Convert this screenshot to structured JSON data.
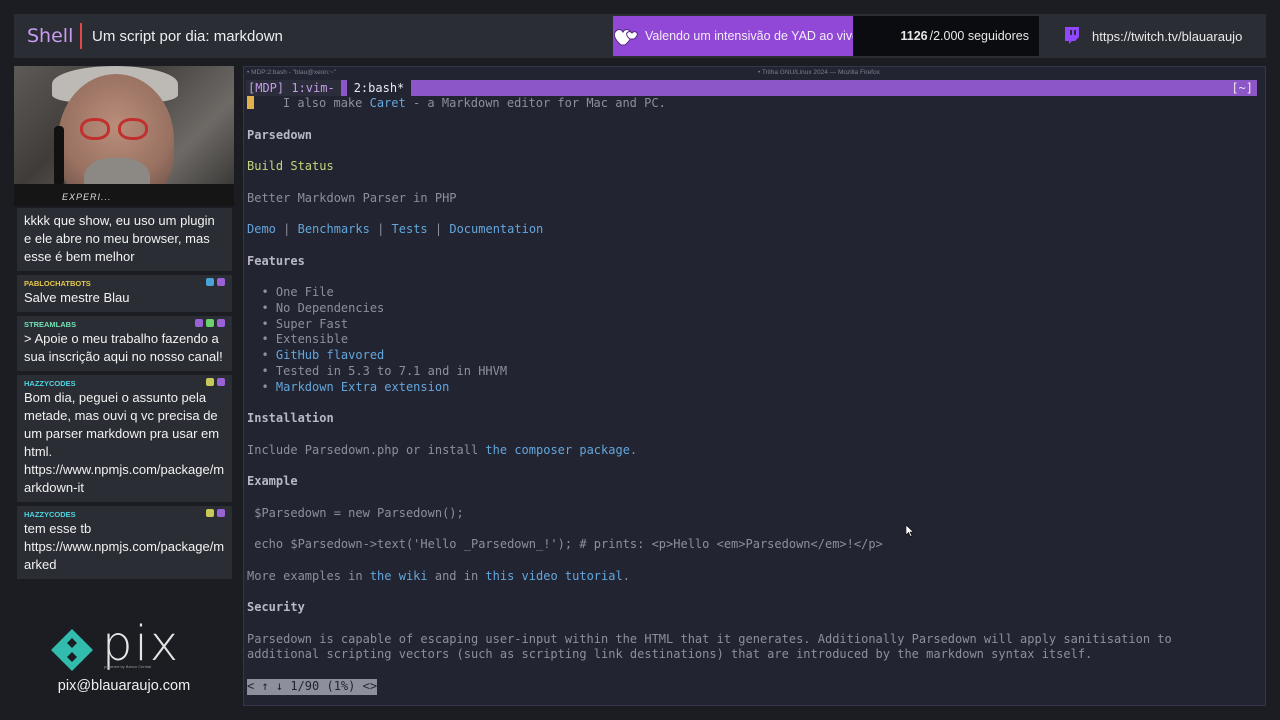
{
  "topbar": {
    "brand": "Shell",
    "title": "Um script por dia: markdown",
    "promo_text": "Valendo um intensivão de YAD ao vivo",
    "followers_count": "1126",
    "followers_goal": "/2.000 seguidores",
    "twitch_url": "https://twitch.tv/blauaraujo",
    "colors": {
      "promo_bg": "#9248d6",
      "brand": "#c89cf0"
    }
  },
  "webcam": {
    "shirt_text": "EXPERI..."
  },
  "chat": [
    {
      "user": "",
      "user_color": "#ffffff",
      "text": "kkkk que show, eu uso um plugin e ele abre no meu browser, mas esse é bem melhor",
      "badges": []
    },
    {
      "user": "PABLOCHATBOTS",
      "user_color": "#e6c84a",
      "text": "Salve mestre Blau",
      "badges": [
        "#4aa3d8",
        "#9a62d6"
      ]
    },
    {
      "user": "STREAMLABS",
      "user_color": "#74e0b4",
      "text": "> Apoie o meu trabalho fazendo a sua inscrição aqui no nosso canal!",
      "badges": [
        "#9a62d6",
        "#6bd36b",
        "#9a62d6"
      ]
    },
    {
      "user": "HAZZYCODES",
      "user_color": "#4fd4e0",
      "text": "Bom dia, peguei o assunto pela metade, mas ouvi q vc precisa de um parser markdown pra usar em html. https://www.npmjs.com/package/markdown-it",
      "badges": [
        "#c9c95a",
        "#9a62d6"
      ]
    },
    {
      "user": "HAZZYCODES",
      "user_color": "#4fd4e0",
      "text": "tem esse tb https://www.npmjs.com/package/marked",
      "badges": [
        "#c9c95a",
        "#9a62d6"
      ]
    }
  ],
  "pix": {
    "word": "pix",
    "sub": "powered by Banco Central",
    "email": "pix@blauaraujo.com"
  },
  "terminal": {
    "window_title_left": "• MDP:2:bash - \"blau@xeon:~\"",
    "window_title_center": "• Trilha GNU/Linux 2024 — Mozilla Firefox",
    "tmux_tab1": "[MDP] 1:vim-",
    "tmux_tab2": "2:bash*",
    "tmux_right": "[~]",
    "lines": [
      [
        {
          "t": "    I also make "
        },
        {
          "t": "Caret",
          "c": "lnk"
        },
        {
          "t": " - a Markdown editor for Mac and PC."
        }
      ],
      [],
      [
        {
          "t": "Parsedown",
          "c": "h"
        }
      ],
      [],
      [
        {
          "t": "Build Status",
          "c": "grn"
        }
      ],
      [],
      [
        {
          "t": "Better Markdown Parser in PHP"
        }
      ],
      [],
      [
        {
          "t": "Demo",
          "c": "lnk"
        },
        {
          "t": " | "
        },
        {
          "t": "Benchmarks",
          "c": "lnk"
        },
        {
          "t": " | "
        },
        {
          "t": "Tests",
          "c": "lnk"
        },
        {
          "t": " | "
        },
        {
          "t": "Documentation",
          "c": "lnk"
        }
      ],
      [],
      [
        {
          "t": "Features",
          "c": "h"
        }
      ],
      [],
      [
        {
          "t": "  • One File"
        }
      ],
      [
        {
          "t": "  • No Dependencies"
        }
      ],
      [
        {
          "t": "  • Super Fast"
        }
      ],
      [
        {
          "t": "  • Extensible"
        }
      ],
      [
        {
          "t": "  • "
        },
        {
          "t": "GitHub flavored",
          "c": "lnk"
        }
      ],
      [
        {
          "t": "  • Tested in 5.3 to 7.1 and in HHVM"
        }
      ],
      [
        {
          "t": "  • "
        },
        {
          "t": "Markdown Extra extension",
          "c": "lnk"
        }
      ],
      [],
      [
        {
          "t": "Installation",
          "c": "h"
        }
      ],
      [],
      [
        {
          "t": "Include Parsedown.php or install "
        },
        {
          "t": "the composer package",
          "c": "lnk"
        },
        {
          "t": "."
        }
      ],
      [],
      [
        {
          "t": "Example",
          "c": "h"
        }
      ],
      [],
      [
        {
          "t": " $Parsedown = new Parsedown();"
        }
      ],
      [],
      [
        {
          "t": " echo $Parsedown->text('Hello _Parsedown_!'); # prints: <p>Hello <em>Parsedown</em>!</p>"
        }
      ],
      [],
      [
        {
          "t": "More examples in "
        },
        {
          "t": "the wiki",
          "c": "lnk"
        },
        {
          "t": " and in "
        },
        {
          "t": "this video tutorial",
          "c": "lnk"
        },
        {
          "t": "."
        }
      ],
      [],
      [
        {
          "t": "Security",
          "c": "h"
        }
      ],
      [],
      [
        {
          "t": "Parsedown is capable of escaping user-input within the HTML that it generates. Additionally Parsedown will apply sanitisation to"
        }
      ],
      [
        {
          "t": "additional scripting vectors (such as scripting link destinations) that are introduced by the markdown syntax itself."
        }
      ],
      [],
      [
        {
          "t": "< ↑ ↓ 1/90 (1%) <>",
          "c": "status"
        }
      ]
    ]
  }
}
